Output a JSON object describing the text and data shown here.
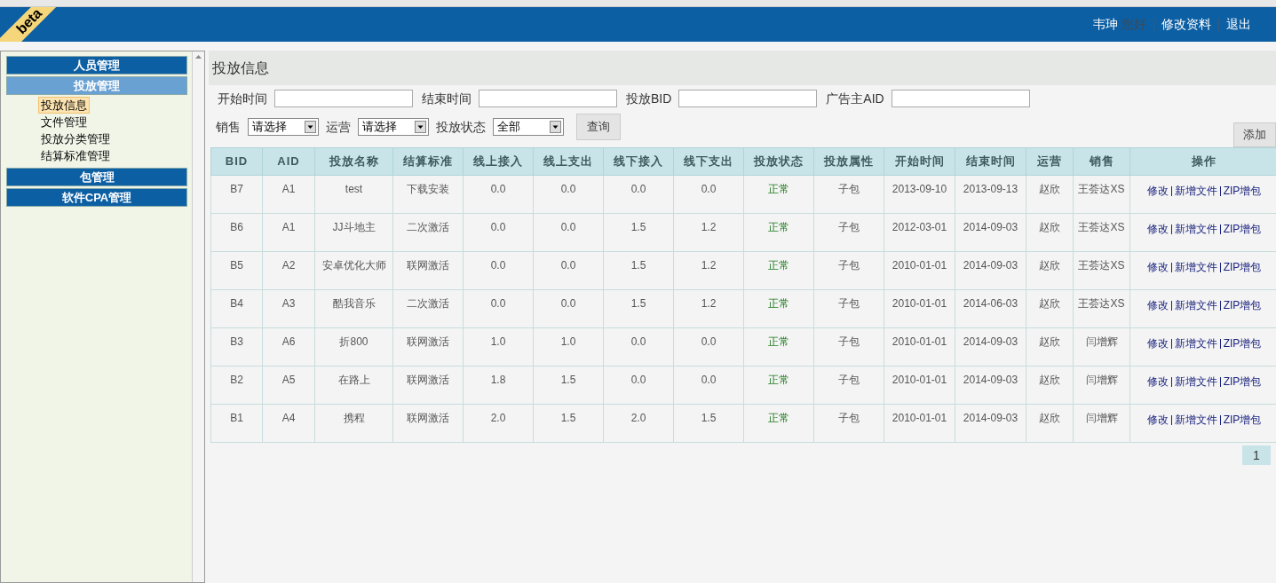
{
  "header": {
    "badge": "beta",
    "user": "韦珅",
    "greeting": "您好",
    "links": [
      "修改资料",
      "退出"
    ]
  },
  "sidebar": {
    "groups": [
      {
        "label": "人员管理",
        "expanded": false
      },
      {
        "label": "投放管理",
        "expanded": true,
        "items": [
          {
            "label": "投放信息",
            "selected": true
          },
          {
            "label": "文件管理",
            "selected": false
          },
          {
            "label": "投放分类管理",
            "selected": false
          },
          {
            "label": "结算标准管理",
            "selected": false
          }
        ]
      },
      {
        "label": "包管理",
        "expanded": false
      },
      {
        "label": "软件CPA管理",
        "expanded": false
      }
    ]
  },
  "page_title": "投放信息",
  "filters": {
    "fields": [
      {
        "label": "开始时间"
      },
      {
        "label": "结束时间"
      },
      {
        "label": "投放BID"
      },
      {
        "label": "广告主AID"
      }
    ],
    "selects": [
      {
        "label": "销售",
        "value": "请选择"
      },
      {
        "label": "运营",
        "value": "请选择"
      },
      {
        "label": "投放状态",
        "value": "全部"
      }
    ],
    "query_button": "查询"
  },
  "add_button": "添加",
  "table": {
    "columns": [
      "BID",
      "AID",
      "投放名称",
      "结算标准",
      "线上接入",
      "线上支出",
      "线下接入",
      "线下支出",
      "投放状态",
      "投放属性",
      "开始时间",
      "结束时间",
      "运营",
      "销售",
      "操作"
    ],
    "rows": [
      {
        "cells": [
          "B7",
          "A1",
          "test",
          "下载安装",
          "0.0",
          "0.0",
          "0.0",
          "0.0",
          "正常",
          "子包",
          "2013-09-10",
          "2013-09-13",
          "赵欣",
          "王荟达XS"
        ],
        "actions": [
          "修改",
          "新增文件",
          "ZIP增包"
        ]
      },
      {
        "cells": [
          "B6",
          "A1",
          "JJ斗地主",
          "二次激活",
          "0.0",
          "0.0",
          "1.5",
          "1.2",
          "正常",
          "子包",
          "2012-03-01",
          "2014-09-03",
          "赵欣",
          "王荟达XS"
        ],
        "actions": [
          "修改",
          "新增文件",
          "ZIP增包"
        ]
      },
      {
        "cells": [
          "B5",
          "A2",
          "安卓优化大师",
          "联网激活",
          "0.0",
          "0.0",
          "1.5",
          "1.2",
          "正常",
          "子包",
          "2010-01-01",
          "2014-09-03",
          "赵欣",
          "王荟达XS"
        ],
        "actions": [
          "修改",
          "新增文件",
          "ZIP增包"
        ]
      },
      {
        "cells": [
          "B4",
          "A3",
          "酷我音乐",
          "二次激活",
          "0.0",
          "0.0",
          "1.5",
          "1.2",
          "正常",
          "子包",
          "2010-01-01",
          "2014-06-03",
          "赵欣",
          "王荟达XS"
        ],
        "actions": [
          "修改",
          "新增文件",
          "ZIP增包"
        ]
      },
      {
        "cells": [
          "B3",
          "A6",
          "折800",
          "联网激活",
          "1.0",
          "1.0",
          "0.0",
          "0.0",
          "正常",
          "子包",
          "2010-01-01",
          "2014-09-03",
          "赵欣",
          "闫增辉"
        ],
        "actions": [
          "修改",
          "新增文件",
          "ZIP增包"
        ]
      },
      {
        "cells": [
          "B2",
          "A5",
          "在路上",
          "联网激活",
          "1.8",
          "1.5",
          "0.0",
          "0.0",
          "正常",
          "子包",
          "2010-01-01",
          "2014-09-03",
          "赵欣",
          "闫增辉"
        ],
        "actions": [
          "修改",
          "新增文件",
          "ZIP增包"
        ]
      },
      {
        "cells": [
          "B1",
          "A4",
          "携程",
          "联网激活",
          "2.0",
          "1.5",
          "2.0",
          "1.5",
          "正常",
          "子包",
          "2010-01-01",
          "2014-09-03",
          "赵欣",
          "闫增辉"
        ],
        "actions": [
          "修改",
          "新增文件",
          "ZIP增包"
        ]
      }
    ]
  },
  "pagination": [
    {
      "label": "1",
      "selected": true
    }
  ]
}
